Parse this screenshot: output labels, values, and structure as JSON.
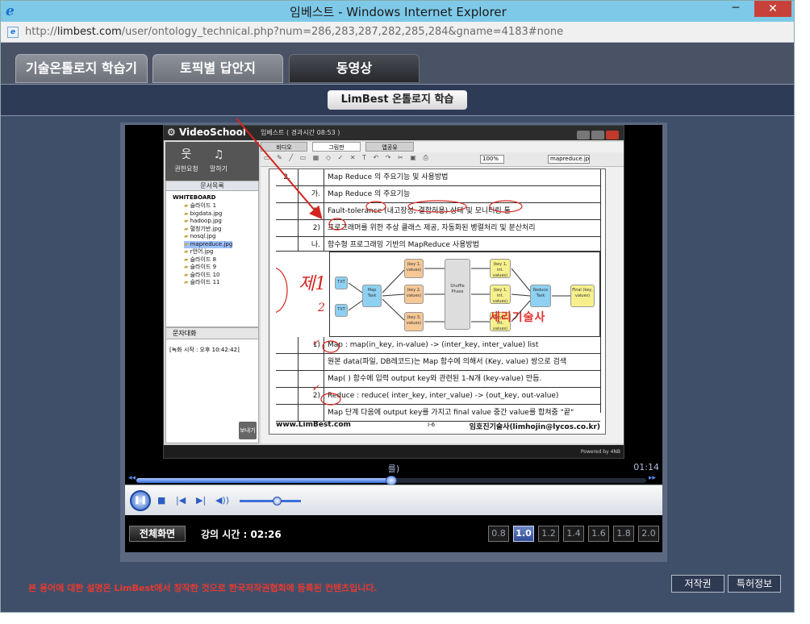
{
  "window": {
    "title": "임베스트 - Windows Internet Explorer",
    "minimize": "─",
    "close": "✕",
    "ie_logo": "e"
  },
  "address": {
    "prefix": "http://",
    "domain": "limbest.com",
    "path": "/user/ontology_technical.php?num=286,283,287,282,285,284&gname=4183#none"
  },
  "tabs": [
    {
      "label": "기술온톨로지 학습기",
      "active": false
    },
    {
      "label": "토픽별 답안지",
      "active": false
    },
    {
      "label": "동영상",
      "active": true
    }
  ],
  "subheader": {
    "title": "LimBest 온톨로지 학습"
  },
  "video": {
    "app_name": "VideoSchool",
    "window_caption": "임베스트 ( 경과시간 08:53 )",
    "tools": [
      {
        "glyph": "웃",
        "label": "권한요청"
      },
      {
        "glyph": "♫",
        "label": "말하기"
      }
    ],
    "tree_header": "문서목록",
    "tree_root": "WHITEBOARD",
    "tree_items": [
      "슬라이드 1",
      "bigdata.jpg",
      "hadoop.jpg",
      "혈청기반.jpg",
      "nosql.jpg",
      "mapreduce.jpg",
      "r언어.jpg",
      "슬라이드 8",
      "슬라이드 9",
      "슬라이드 10",
      "슬라이드 11"
    ],
    "tree_selected": "mapreduce.jpg",
    "chat_header": "문자대화",
    "chat_line": "[녹화 시작 : 오후 10:42:42]",
    "send_label": "보내기",
    "tabs": [
      "비디오",
      "그림판",
      "앱공유"
    ],
    "zoom": "100%",
    "file": "mapreduce.jpg",
    "powered": "Powered by 4NB"
  },
  "slide": {
    "rows": [
      {
        "num": "2.",
        "num2": "",
        "text": "Map Reduce 의 주요기능 및 사용방법"
      },
      {
        "num": "",
        "num2": "가.",
        "text": "Map Reduce 의 주요기능"
      },
      {
        "num": "",
        "num2": "1)",
        "text": "Fault-tolerance (내고장성, 결함허용) 상태 및 모니터링 툴"
      },
      {
        "num": "",
        "num2": "2)",
        "text": "프로그래머를 위한 추상 클래스 제공, 자동화된 병렬처리 및 분산처리"
      },
      {
        "num": "",
        "num2": "나.",
        "text": "함수형 프로그래밍 기반의 MapReduce 사용방법"
      },
      {
        "num": "",
        "num2": "1)",
        "text": "Map : map(in_key, in-value) -> (inter_key, inter_value) list"
      },
      {
        "num": "",
        "num2": "",
        "text": "원본 data(파일, DB레코드)는 Map 함수에 의해서 (Key, value) 쌍으로 검색"
      },
      {
        "num": "",
        "num2": "",
        "text": "Map(  ) 함수에 입력 output key와 관련된 1-N개 (key-value) 만듬."
      },
      {
        "num": "",
        "num2": "2)",
        "text": "Reduce : reduce( inter_key, inter_value) -> (out_key, out-value)"
      },
      {
        "num": "",
        "num2": "",
        "text": "Map 단계 다음에 output key를 가지고 final value 중간 value를 합쳐줌  \"끝\""
      }
    ],
    "diagram": {
      "txt": "TXT",
      "map_task": "Map Task",
      "kv_in": [
        "(key 1, values)",
        "(key 2, values)",
        "(key 3, values)"
      ],
      "shuffle": "Shuffle Phase",
      "kv_out": [
        "(key 1, int. values)",
        "(key 1, int. values)",
        "(key 1, int. values)"
      ],
      "reduce_task": "Reduce Task",
      "final": "Final (key, values)"
    },
    "watermark": "세리기술사",
    "footer_left": "www.LimBest.com",
    "footer_center": "I-6",
    "footer_right": "임호진기술사(limhojin@lycos.co.kr)",
    "ink_notes": [
      "제1",
      "2",
      "✓",
      "✓"
    ]
  },
  "player": {
    "subtitle": "를)",
    "total_time": "01:14",
    "progress": 0.5,
    "volume": 0.6,
    "seek_left": "◂◂",
    "seek_right": "▸▸",
    "play_glyph": "❚❚",
    "stop_glyph": "■",
    "prev_glyph": "|◀",
    "next_glyph": "▶|",
    "volume_glyph": "◀))",
    "fullscreen_label": "전체화면",
    "lecture_time_label": "강의 시간 : 02:26",
    "speeds": [
      "0.8",
      "1.0",
      "1.2",
      "1.4",
      "1.6",
      "1.8",
      "2.0"
    ],
    "speed_selected": "1.0"
  },
  "footer": {
    "notice": "본 용어에 대한 설명은 LimBest에서 창작한 것으로 한국저작권협회에 등록된 컨텐츠입니다.",
    "buttons": [
      "저작권",
      "특허정보"
    ]
  },
  "colors": {
    "title_bar": "#7ec9e8",
    "notice_red": "#e8392f",
    "accent_blue": "#2c62c8"
  }
}
